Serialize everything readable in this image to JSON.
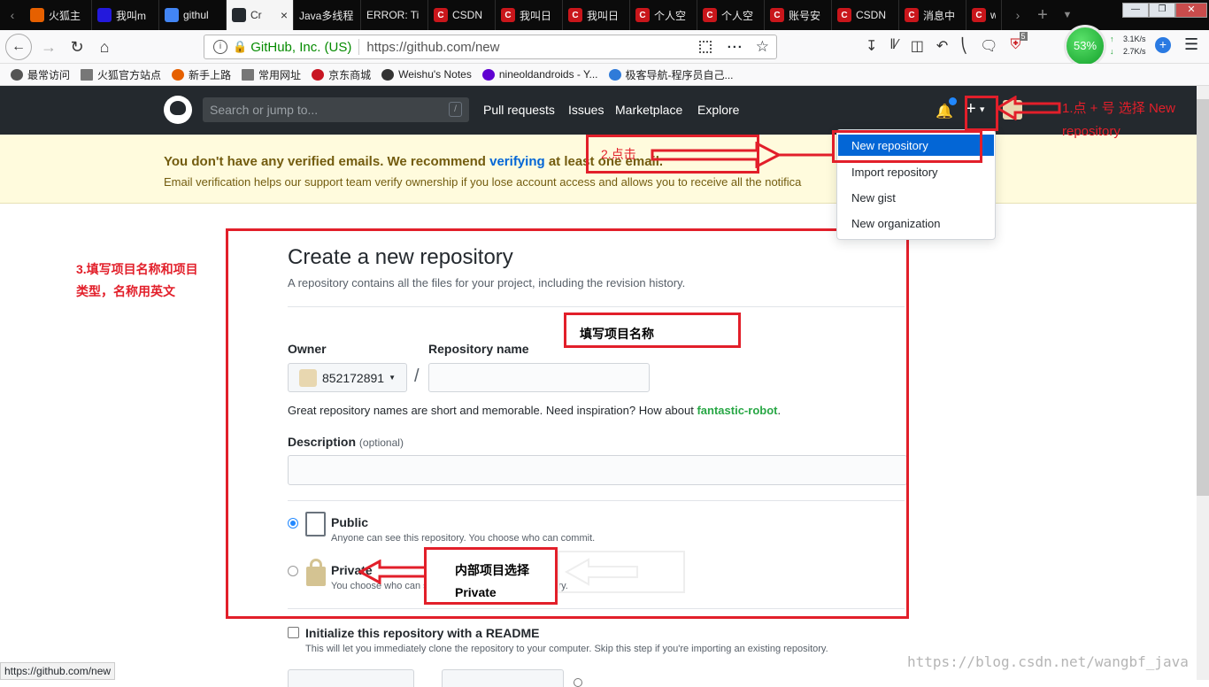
{
  "browser": {
    "tabs": [
      {
        "label": "火狐主",
        "icon": "firefox-icon",
        "color": "#e66000"
      },
      {
        "label": "我叫m",
        "icon": "baidu-icon",
        "color": "#2319dc"
      },
      {
        "label": "githul",
        "icon": "google-icon",
        "color": "#4285f4"
      },
      {
        "label": "Cr",
        "icon": "github-icon",
        "color": "#24292e",
        "active": true
      },
      {
        "label": "Java多线程",
        "icon": "",
        "color": ""
      },
      {
        "label": "ERROR: Ti",
        "icon": "",
        "color": ""
      },
      {
        "label": "CSDN",
        "icon": "csdn-icon",
        "color": "#c9161b"
      },
      {
        "label": "我叫日",
        "icon": "csdn-icon",
        "color": "#c9161b"
      },
      {
        "label": "我叫日",
        "icon": "csdn-icon",
        "color": "#c9161b"
      },
      {
        "label": "个人空",
        "icon": "csdn-icon",
        "color": "#c9161b"
      },
      {
        "label": "个人空",
        "icon": "csdn-icon",
        "color": "#c9161b"
      },
      {
        "label": "账号安",
        "icon": "csdn-icon",
        "color": "#c9161b"
      },
      {
        "label": "CSDN",
        "icon": "csdn-icon",
        "color": "#c9161b"
      },
      {
        "label": "消息中",
        "icon": "csdn-icon",
        "color": "#c9161b"
      },
      {
        "label": "w",
        "icon": "csdn-icon",
        "color": "#c9161b"
      }
    ],
    "url_identity": "GitHub, Inc. (US)",
    "url": "https://github.com/new",
    "net_percent": "53%",
    "net_up": "3.1K/s",
    "net_down": "2.7K/s",
    "ext_badge": "5",
    "bookmarks": [
      "最常访问",
      "火狐官方站点",
      "新手上路",
      "常用网址",
      "京东商城",
      "Weishu's Notes",
      "nineoldandroids - Y...",
      "极客导航-程序员自己..."
    ],
    "status_url": "https://github.com/new"
  },
  "github": {
    "search_placeholder": "Search or jump to...",
    "search_key": "/",
    "nav": [
      "Pull requests",
      "Issues",
      "Marketplace",
      "Explore"
    ],
    "plus_menu": [
      "New repository",
      "Import repository",
      "New gist",
      "New organization"
    ],
    "flash_title_a": "You don't have any verified emails. We recommend ",
    "flash_link": "verifying",
    "flash_title_b": " at least one email.",
    "flash_body": "Email verification helps our support team verify ownership if you lose account access and allows you to receive all the notifica",
    "page_title": "Create a new repository",
    "page_subtitle": "A repository contains all the files for your project, including the revision history.",
    "owner_label": "Owner",
    "owner_value": "852172891",
    "repo_label": "Repository name",
    "slash": "/",
    "hint_a": "Great repository names are short and memorable. Need inspiration? How about ",
    "hint_link": "fantastic-robot",
    "hint_b": ".",
    "desc_label": "Description",
    "desc_optional": "(optional)",
    "public_label": "Public",
    "public_desc": "Anyone can see this repository. You choose who can commit.",
    "private_label": "Private",
    "private_desc": "You choose who can see and commit to this repository.",
    "readme_label": "Initialize this repository with a README",
    "readme_desc": "This will let you immediately clone the repository to your computer. Skip this step if you're importing an existing repository."
  },
  "annotations": {
    "step1": "1.点 + 号  选择 New repository",
    "step2": "2.点击",
    "step3": "3.填写项目名称和项目类型，名称用英文",
    "fill_name": "填写项目名称",
    "private_note_a": "内部项目选择",
    "private_note_b": "Private",
    "watermark": "https://blog.csdn.net/wangbf_java"
  },
  "colors": {
    "annotation_red": "#e21f2a",
    "gh_header": "#24292e",
    "flash_bg": "#fffbdd",
    "menu_highlight": "#0366d6"
  }
}
